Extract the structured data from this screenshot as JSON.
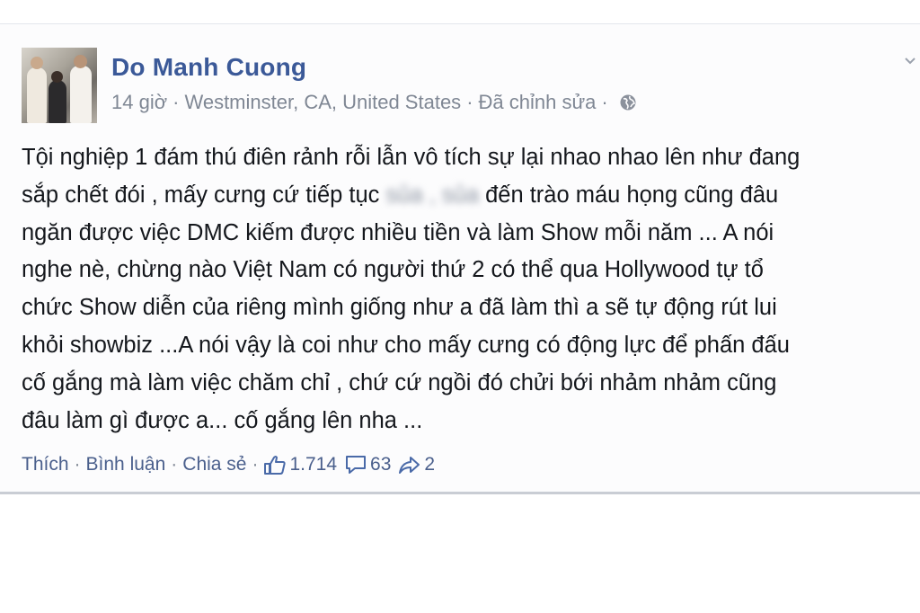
{
  "post": {
    "author": "Do Manh Cuong",
    "time": "14 giờ",
    "location": "Westminster, CA, United States",
    "edited": "Đã chỉnh sửa",
    "separator": "·",
    "privacy_icon": "globe-icon",
    "body_lines": [
      "Tội nghiệp 1 đám thú điên rảnh rỗi lẫn vô tích sự lại nhao nhao lên như đang",
      "sắp chết đói , mấy cưng cứ tiếp tục",
      "sủa , sủa",
      "đến trào máu họng cũng đâu",
      "ngăn được việc DMC kiếm được nhiều tiền và làm Show mỗi năm ... A nói",
      "nghe nè, chừng nào Việt Nam có người thứ 2 có thể qua Hollywood tự tổ",
      "chức Show diễn của riêng mình giống như a đã làm thì a sẽ tự động rút lui",
      "khỏi showbiz ...A nói vậy là coi như cho mấy cưng có động lực để phấn đấu",
      "cố gắng mà làm việc chăm chỉ , chứ cứ ngồi đó chửi bới nhảm nhảm cũng",
      "đâu làm gì được a... cố gắng lên nha ..."
    ]
  },
  "actions": {
    "like_label": "Thích",
    "comment_label": "Bình luận",
    "share_label": "Chia sẻ",
    "separator": "·",
    "likes_count": "1.714",
    "comments_count": "63",
    "shares_count": "2",
    "like_icon": "thumbs-up-icon",
    "comment_icon": "comment-bubble-icon",
    "share_icon": "share-arrow-icon"
  },
  "colors": {
    "name_blue": "#3b5998",
    "meta_gray": "#7f8794",
    "action_blue": "#4a5f8c"
  }
}
